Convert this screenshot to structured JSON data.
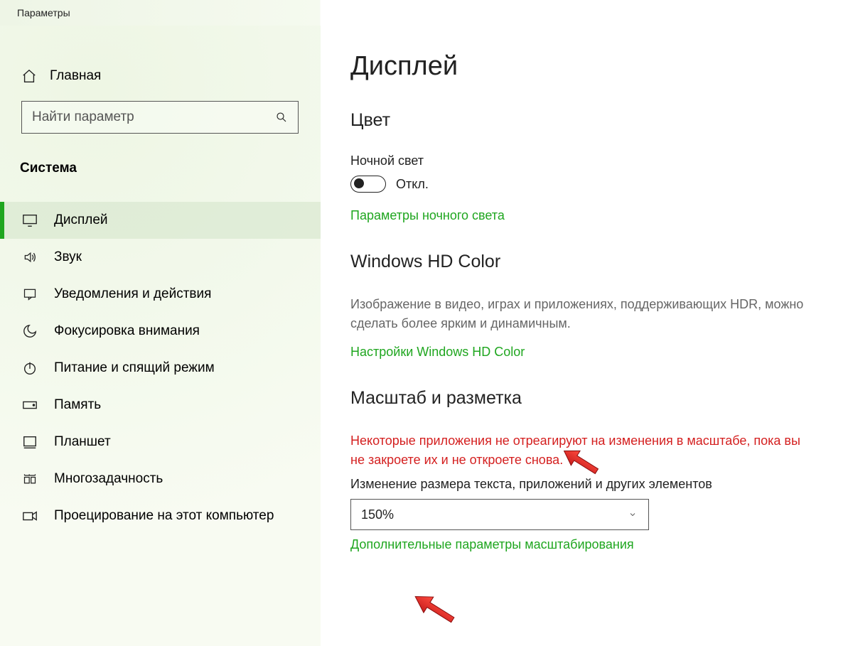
{
  "window": {
    "title": "Параметры"
  },
  "sidebar": {
    "home": "Главная",
    "search_placeholder": "Найти параметр",
    "category": "Система",
    "items": [
      {
        "label": "Дисплей",
        "active": true
      },
      {
        "label": "Звук"
      },
      {
        "label": "Уведомления и действия"
      },
      {
        "label": "Фокусировка внимания"
      },
      {
        "label": "Питание и спящий режим"
      },
      {
        "label": "Память"
      },
      {
        "label": "Планшет"
      },
      {
        "label": "Многозадачность"
      },
      {
        "label": "Проецирование на этот компьютер"
      }
    ]
  },
  "page": {
    "title": "Дисплей",
    "color": {
      "heading": "Цвет",
      "night_light_label": "Ночной свет",
      "night_light_state": "Откл.",
      "night_light_link": "Параметры ночного света"
    },
    "hdcolor": {
      "heading": "Windows HD Color",
      "desc": "Изображение в видео, играх и приложениях, поддерживающих HDR, можно сделать более ярким и динамичным.",
      "link": "Настройки Windows HD Color"
    },
    "scale": {
      "heading": "Масштаб и разметка",
      "warning": "Некоторые приложения не отреагируют на изменения в масштабе, пока вы не закроете их и не откроете снова.",
      "resize_label": "Изменение размера текста, приложений и других элементов",
      "value": "150%",
      "advanced_link": "Дополнительные параметры масштабирования"
    }
  }
}
